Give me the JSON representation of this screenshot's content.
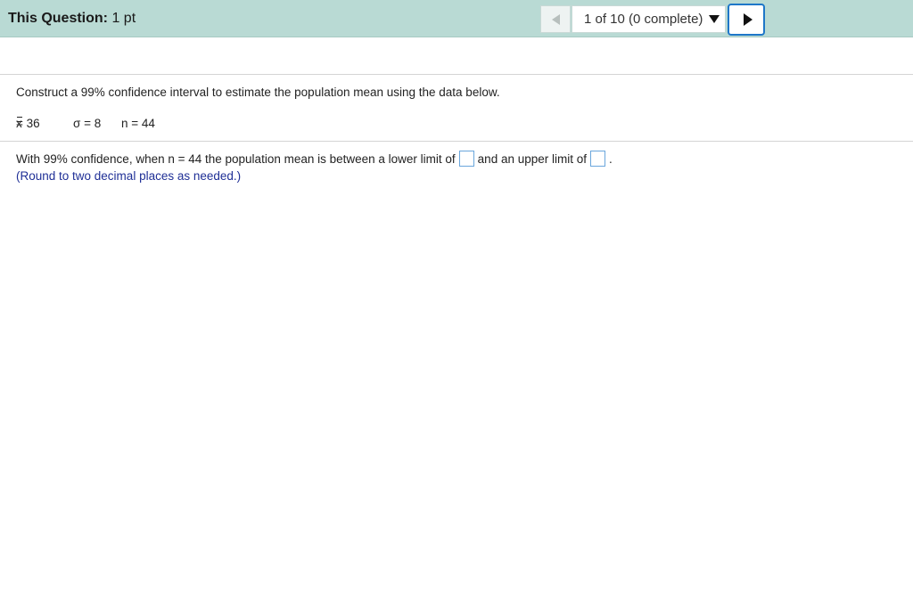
{
  "header": {
    "title_label": "This Question:",
    "title_value": "1 pt",
    "progress_select": "1 of 10 (0 complete)",
    "prev_icon": "triangle-left-icon",
    "next_icon": "triangle-right-icon",
    "dropdown_icon": "triangle-down-icon"
  },
  "question": {
    "prompt": "Construct a 99% confidence interval to estimate the population mean using the data below.",
    "data": {
      "xbar_label": "x",
      "xbar_value": " = 36",
      "sigma": "σ = 8",
      "n": "n = 44"
    },
    "answer_part1": "With 99% confidence, when n = 44 the population mean is between a lower limit of",
    "answer_part2": "and an upper limit of",
    "answer_part3": ".",
    "hint": "(Round to two decimal places as needed.)"
  },
  "colors": {
    "header_bg": "#b9dad4",
    "next_border": "#1e77c8",
    "hint_text": "#1f2f96",
    "input_border": "#6aa6dc"
  }
}
